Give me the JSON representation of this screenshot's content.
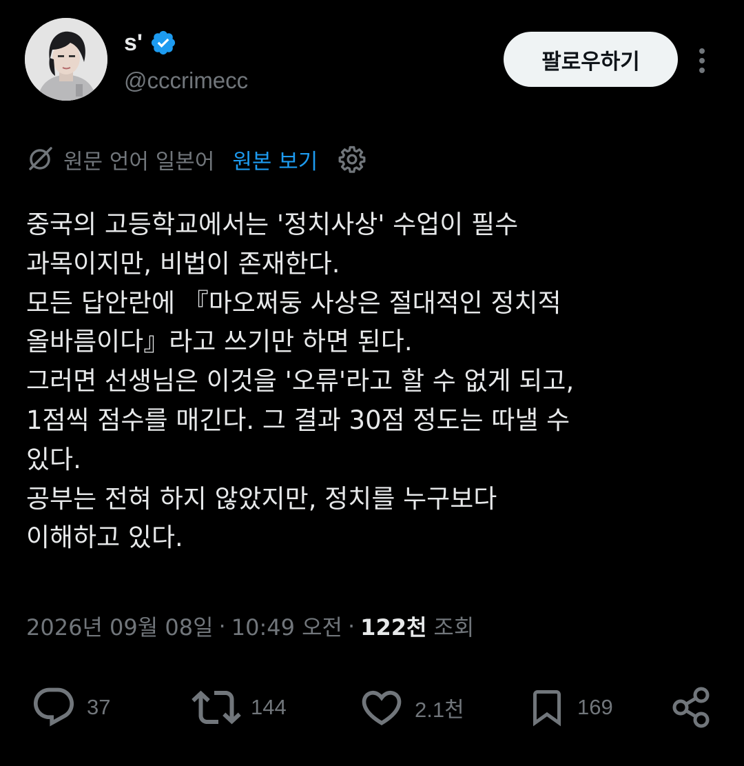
{
  "author": {
    "display_name": "s'",
    "handle": "@cccrimecc",
    "verified_icon": "verified-badge-icon",
    "avatar_icon": "profile-avatar"
  },
  "header": {
    "follow_label": "팔로우하기",
    "more_icon": "more-vertical-icon"
  },
  "translation": {
    "icon": "translate-icon",
    "label": "원문 언어 일본어",
    "show_original_label": "원본 보기",
    "settings_icon": "gear-icon"
  },
  "tweet": {
    "lines": [
      "중국의 고등학교에서는 '정치사상' 수업이 필수",
      "과목이지만, 비법이 존재한다.",
      "모든 답안란에 『마오쩌둥 사상은 절대적인 정치적",
      "올바름이다』라고 쓰기만 하면 된다.",
      "그러면 선생님은 이것을 '오류'라고 할 수 없게 되고,",
      "1점씩 점수를 매긴다. 그 결과 30점 정도는 따낼 수",
      "있다.",
      "공부는 전혀 하지 않았지만, 정치를 누구보다",
      "이해하고 있다."
    ]
  },
  "meta": {
    "date": "2026년 09월 08일",
    "separator": "·",
    "time": "10:49 오전",
    "views_separator": "·",
    "views_count": "122천",
    "views_label": "조회"
  },
  "actions": {
    "reply": {
      "icon": "reply-icon",
      "count": "37"
    },
    "retweet": {
      "icon": "retweet-icon",
      "count": "144"
    },
    "like": {
      "icon": "heart-icon",
      "count": "2.1천"
    },
    "bookmark": {
      "icon": "bookmark-icon",
      "count": "169"
    },
    "share": {
      "icon": "share-icon"
    }
  },
  "colors": {
    "background": "#000000",
    "text_primary": "#e7e9ea",
    "text_secondary": "#71767b",
    "accent": "#1d9bf0",
    "button_bg": "#eff3f4"
  }
}
